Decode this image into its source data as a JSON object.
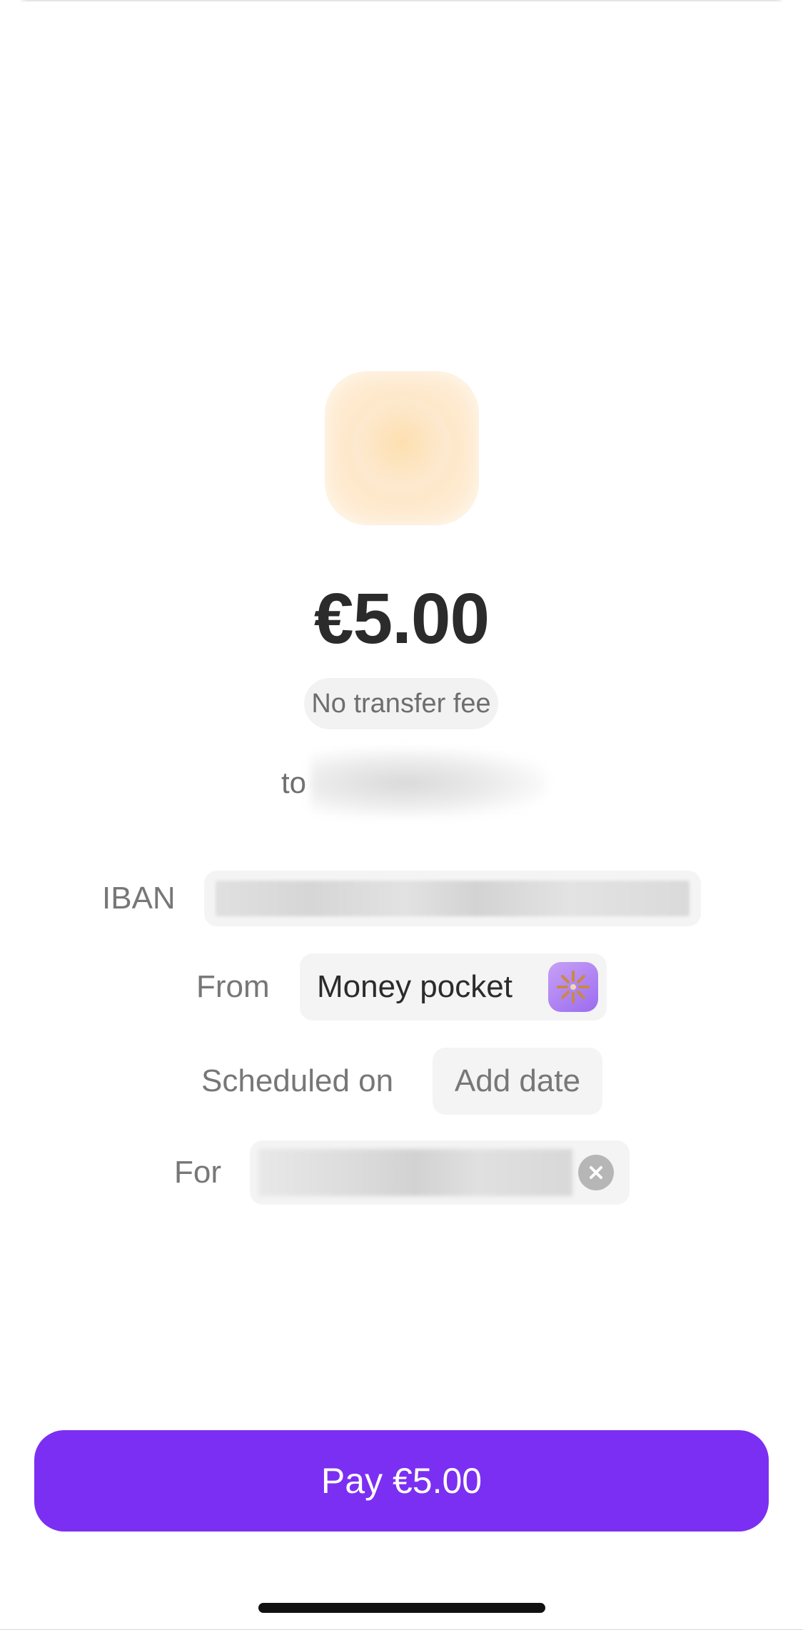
{
  "amount": "€5.00",
  "fee_note": "No transfer fee",
  "recipient": {
    "to_label": "to"
  },
  "details": {
    "iban_label": "IBAN",
    "from_label": "From",
    "from_value": "Money pocket",
    "from_icon": "sparkle-icon",
    "scheduled_label": "Scheduled on",
    "scheduled_value": "Add date",
    "for_label": "For"
  },
  "pay_button": {
    "label": "Pay €5.00",
    "color": "#7b2ff2"
  }
}
